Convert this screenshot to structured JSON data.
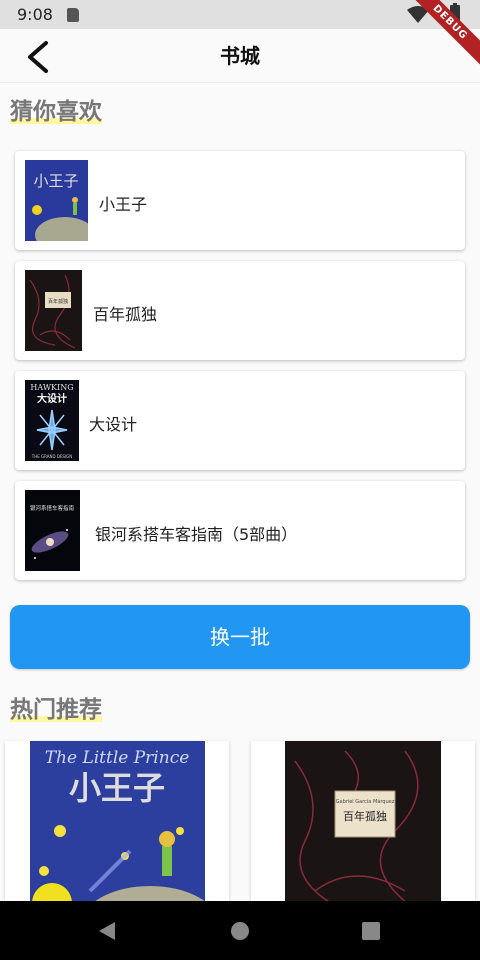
{
  "status": {
    "time": "9:08"
  },
  "debug_label": "DEBUG",
  "app_bar": {
    "title": "书城"
  },
  "guess_section": {
    "title": "猜你喜欢",
    "books": [
      {
        "title": "小王子"
      },
      {
        "title": "百年孤独"
      },
      {
        "title": "大设计"
      },
      {
        "title": "银河系搭车客指南（5部曲）"
      }
    ],
    "refresh_label": "换一批"
  },
  "hot_section": {
    "title": "热门推荐",
    "cover_texts": {
      "little_prince_en": "The Little Prince",
      "little_prince_cn": "小王子",
      "solitude_author": "Gabriel García Márquez",
      "solitude_cn": "百年孤独",
      "hawking_en": "HAWKING",
      "grand_design_cn": "大设计",
      "grand_design_en": "THE GRAND DESIGN",
      "galaxy_cn": "银河系搭车客指南"
    }
  },
  "colors": {
    "accent": "#2196f3",
    "debug": "#b22222"
  }
}
